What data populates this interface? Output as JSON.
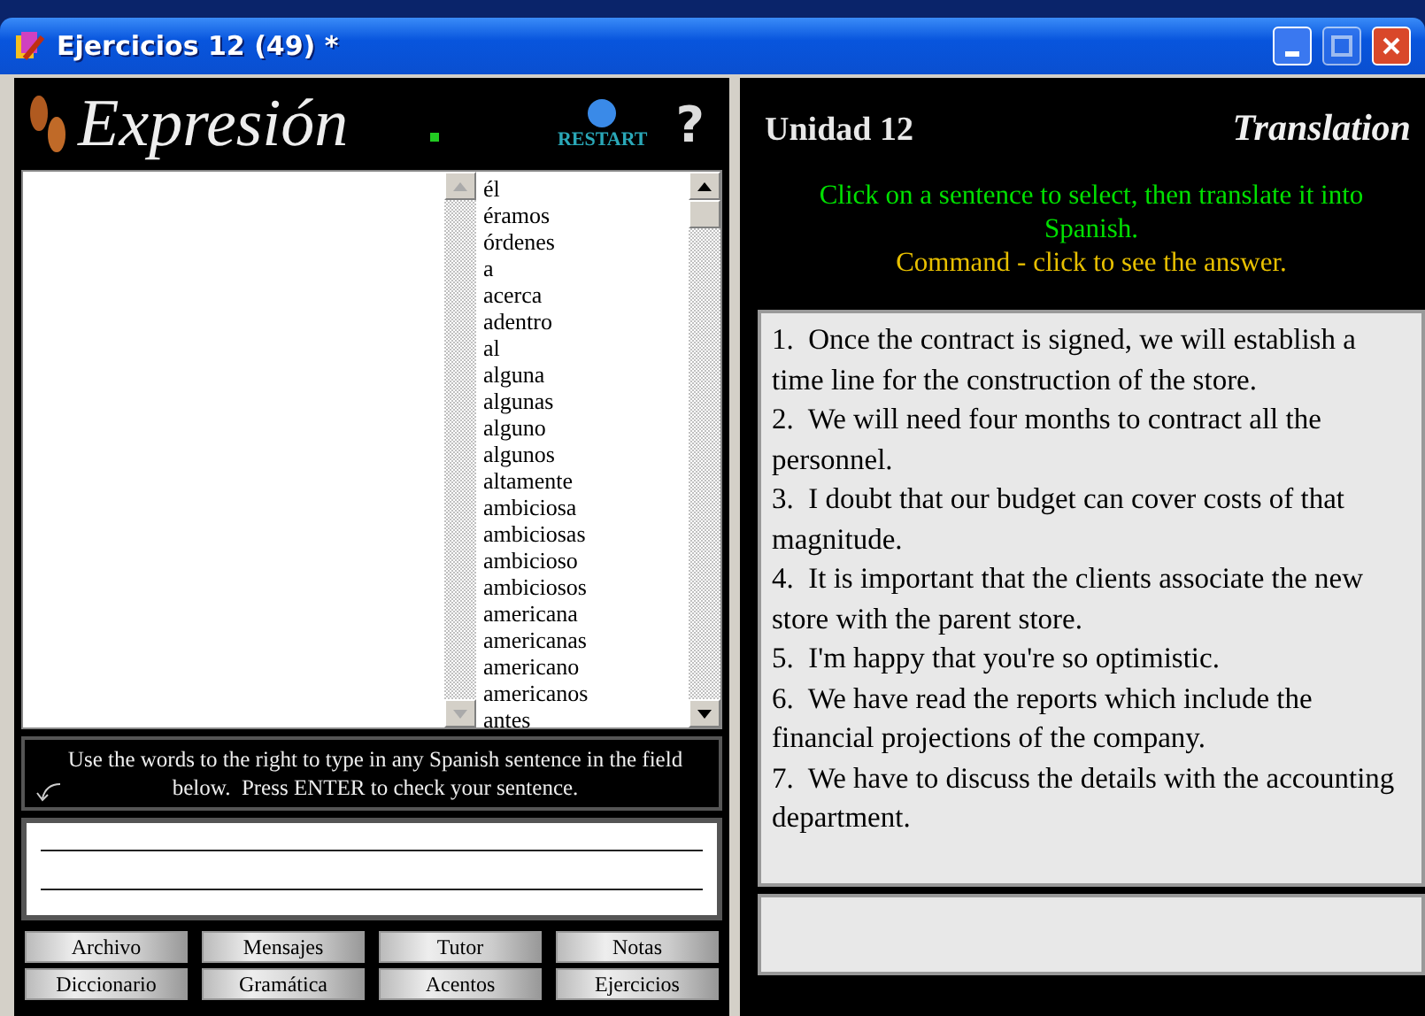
{
  "window": {
    "title": "Ejercicios 12 (49) *"
  },
  "left": {
    "logo": "Expresión",
    "restart": "RESTART",
    "help": "?",
    "words": [
      "él",
      "éramos",
      "órdenes",
      "a",
      "acerca",
      "adentro",
      "al",
      "alguna",
      "algunas",
      "alguno",
      "algunos",
      "altamente",
      "ambiciosa",
      "ambiciosas",
      "ambicioso",
      "ambiciosos",
      "americana",
      "americanas",
      "americano",
      "americanos",
      "antes"
    ],
    "instruction": "Use the words to the right to type in any Spanish sentence in the field below.  Press ENTER to check your sentence.",
    "buttons": [
      [
        "Archivo",
        "Mensajes",
        "Tutor",
        "Notas"
      ],
      [
        "Diccionario",
        "Gramática",
        "Acentos",
        "Ejercicios"
      ]
    ]
  },
  "right": {
    "unit": "Unidad 12",
    "mode": "Translation",
    "instructions": [
      {
        "kind": "hint",
        "text": "Click on a sentence to select, then translate it into Spanish."
      },
      {
        "kind": "command",
        "text": "Command - click to see the answer."
      }
    ],
    "sentences": [
      "1.  Once the contract is signed, we will establish a time line for the construction of the store.",
      "2.  We will need four months to contract all the personnel.",
      "3.  I doubt that our budget can cover costs of that magnitude.",
      "4.  It is important that the clients associate the new store with the parent store.",
      "5.  I'm happy that you're so optimistic.",
      "6.  We have read the reports which include the financial projections of the company.",
      "7.  We have to discuss the details with the accounting department."
    ]
  }
}
